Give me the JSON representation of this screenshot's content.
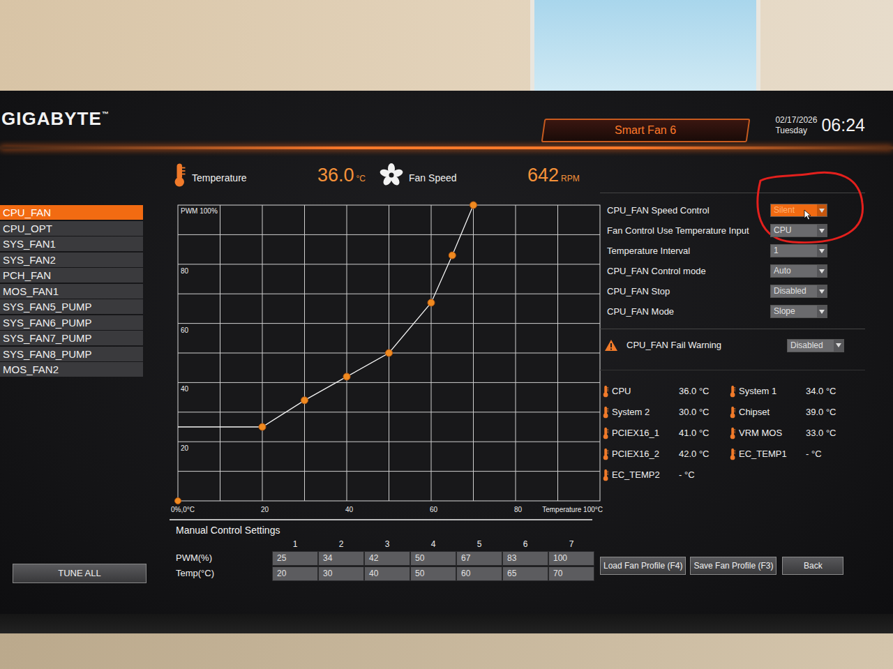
{
  "brand": {
    "logo": "GIGABYTE",
    "trademark": "™"
  },
  "header": {
    "title": "Smart Fan 6",
    "date": "02/17/2026",
    "day": "Tuesday",
    "time": "06:24"
  },
  "readout": {
    "temperature": {
      "label": "Temperature",
      "value": "36.0",
      "unit": "°C"
    },
    "fan_speed": {
      "label": "Fan Speed",
      "value": "642",
      "unit": "RPM"
    }
  },
  "fans": [
    {
      "label": "CPU_FAN",
      "selected": true
    },
    {
      "label": "CPU_OPT",
      "selected": false
    },
    {
      "label": "SYS_FAN1",
      "selected": false
    },
    {
      "label": "SYS_FAN2",
      "selected": false
    },
    {
      "label": "PCH_FAN",
      "selected": false
    },
    {
      "label": "MOS_FAN1",
      "selected": false
    },
    {
      "label": "SYS_FAN5_PUMP",
      "selected": false
    },
    {
      "label": "SYS_FAN6_PUMP",
      "selected": false
    },
    {
      "label": "SYS_FAN7_PUMP",
      "selected": false
    },
    {
      "label": "SYS_FAN8_PUMP",
      "selected": false
    },
    {
      "label": "MOS_FAN2",
      "selected": false
    }
  ],
  "tune_all": "TUNE ALL",
  "chart": {
    "y_title": "PWM 100%",
    "y_ticks": [
      "80",
      "60",
      "40",
      "20"
    ],
    "x_ticks": [
      "0%,0°C",
      "20",
      "40",
      "60",
      "80",
      "Temperature 100°C"
    ],
    "origin": {
      "temp": 0,
      "pwm": 0
    },
    "series": {
      "temp": [
        20,
        30,
        40,
        50,
        60,
        65,
        70
      ],
      "pwm": [
        25,
        34,
        42,
        50,
        67,
        83,
        100
      ]
    }
  },
  "manual": {
    "title": "Manual Control Settings",
    "columns": [
      "1",
      "2",
      "3",
      "4",
      "5",
      "6",
      "7"
    ],
    "rows": [
      {
        "label": "PWM(%)",
        "values": [
          "25",
          "34",
          "42",
          "50",
          "67",
          "83",
          "100"
        ]
      },
      {
        "label": "Temp(°C)",
        "values": [
          "20",
          "30",
          "40",
          "50",
          "60",
          "65",
          "70"
        ]
      }
    ]
  },
  "settings": [
    {
      "label": "CPU_FAN Speed Control",
      "value": "Silent",
      "focused": true
    },
    {
      "label": "Fan Control Use Temperature Input",
      "value": "CPU",
      "focused": false
    },
    {
      "label": "Temperature Interval",
      "value": "1",
      "focused": false
    },
    {
      "label": "CPU_FAN Control mode",
      "value": "Auto",
      "focused": false
    },
    {
      "label": "CPU_FAN Stop",
      "value": "Disabled",
      "focused": false
    },
    {
      "label": "CPU_FAN Mode",
      "value": "Slope",
      "focused": false
    }
  ],
  "warning": {
    "label": "CPU_FAN Fail Warning",
    "value": "Disabled"
  },
  "sensors": [
    {
      "name": "CPU",
      "value": "36.0 °C"
    },
    {
      "name": "System 1",
      "value": "34.0 °C"
    },
    {
      "name": "System 2",
      "value": "30.0 °C"
    },
    {
      "name": "Chipset",
      "value": "39.0 °C"
    },
    {
      "name": "PCIEX16_1",
      "value": "41.0 °C"
    },
    {
      "name": "VRM MOS",
      "value": "33.0 °C"
    },
    {
      "name": "PCIEX16_2",
      "value": "42.0 °C"
    },
    {
      "name": "EC_TEMP1",
      "value": "- °C"
    },
    {
      "name": "EC_TEMP2",
      "value": "- °C"
    }
  ],
  "buttons": [
    "Load Fan Profile (F4)",
    "Save Fan Profile (F3)",
    "Back"
  ]
}
